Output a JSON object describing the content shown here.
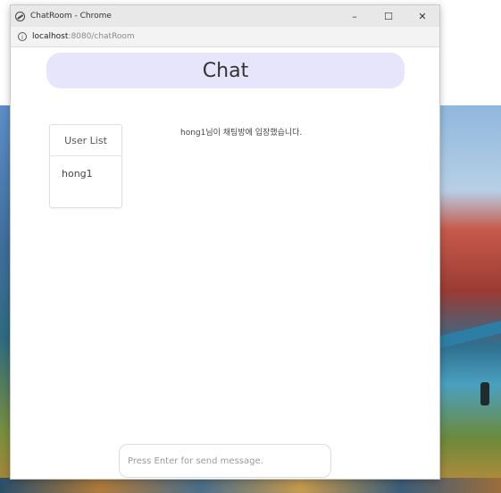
{
  "window": {
    "title": "ChatRoom - Chrome",
    "minimize": "–",
    "maximize": "☐",
    "close": "✕"
  },
  "address": {
    "info": "i",
    "host": "localhost",
    "rest": ":8080/chatRoom"
  },
  "chat": {
    "title": "Chat",
    "user_list_title": "User List",
    "users": [
      "hong1"
    ],
    "messages": [
      "hong1님이 채팅방에 입장했습니다."
    ]
  },
  "input": {
    "placeholder": "Press Enter for send message.",
    "value": ""
  }
}
